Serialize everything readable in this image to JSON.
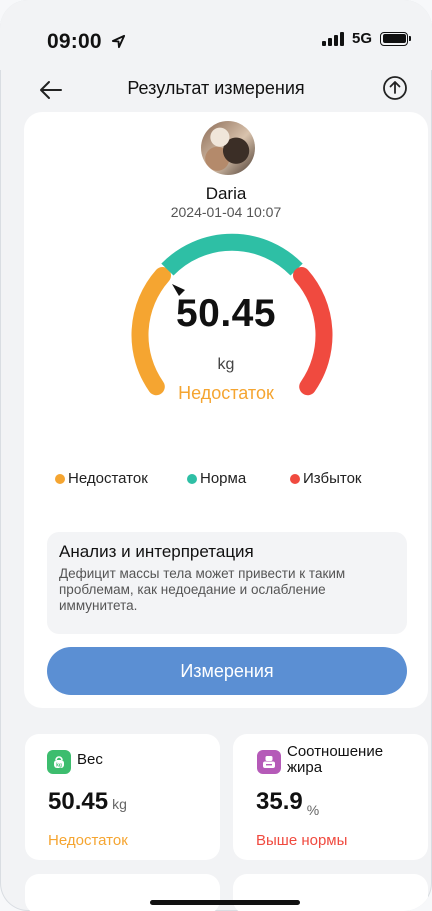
{
  "status_bar": {
    "time": "09:00",
    "network": "5G"
  },
  "header": {
    "title": "Результат измерения"
  },
  "profile": {
    "name": "Daria",
    "date": "2024-01-04 10:07"
  },
  "gauge": {
    "value": "50.45",
    "unit": "kg",
    "status": "Недостаток",
    "colors": {
      "low": "#f5a531",
      "normal": "#2ebfa5",
      "high": "#f04a3f"
    }
  },
  "legend": [
    {
      "label": "Недостаток",
      "color": "#f5a531"
    },
    {
      "label": "Норма",
      "color": "#2ebfa5"
    },
    {
      "label": "Избыток",
      "color": "#f04a3f"
    }
  ],
  "analysis": {
    "title": "Анализ и интерпретация",
    "text": "Дефицит массы тела может привести к таким проблемам, как недоедание и ослабление иммунитета."
  },
  "measure_button": "Измерения",
  "metrics": [
    {
      "label": "Вес",
      "value": "50.45",
      "unit": "kg",
      "status": "Недостаток",
      "status_color": "#f5a531",
      "icon": "kettlebell-icon",
      "icon_color": "#3dbd6e"
    },
    {
      "label": "Соотношение жира",
      "value": "35.9",
      "unit": "%",
      "status": "Выше  нормы",
      "status_color": "#f04a3f",
      "icon": "body-fat-icon",
      "icon_color": "#b55ab8"
    }
  ]
}
